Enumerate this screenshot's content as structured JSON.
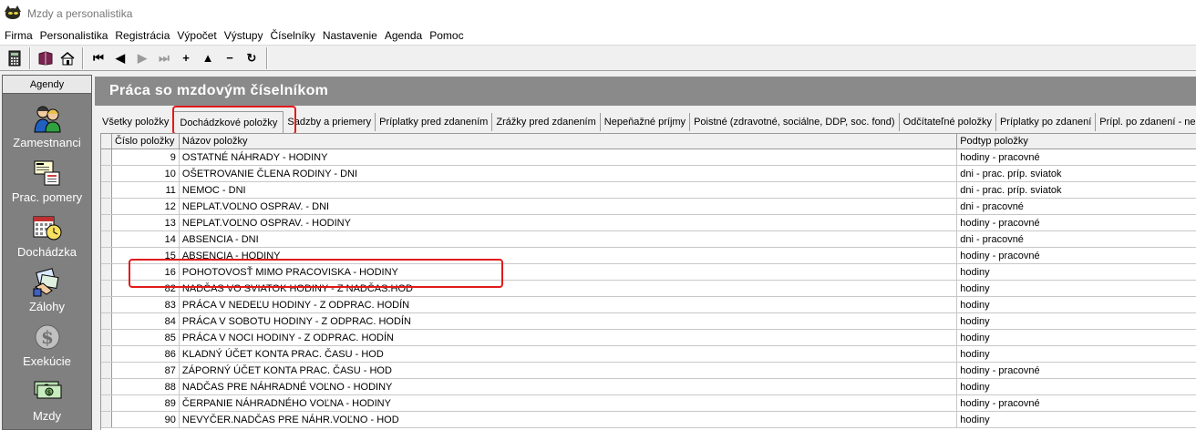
{
  "app": {
    "title": "Mzdy a personalistika",
    "logo_icon": "cat-logo-icon"
  },
  "menu": [
    "Firma",
    "Personalistika",
    "Registrácia",
    "Výpočet",
    "Výstupy",
    "Číselníky",
    "Nastavenie",
    "Agenda",
    "Pomoc"
  ],
  "toolbar": {
    "group1": [
      "calculator-icon",
      "book-icon",
      "home-icon"
    ],
    "nav": [
      {
        "icon": "first-record-icon",
        "glyph": "⏮",
        "disabled": false
      },
      {
        "icon": "prev-record-icon",
        "glyph": "◀",
        "disabled": false
      },
      {
        "icon": "next-record-icon",
        "glyph": "▶",
        "disabled": true
      },
      {
        "icon": "last-record-icon",
        "glyph": "⏭",
        "disabled": true
      },
      {
        "icon": "add-record-icon",
        "glyph": "+",
        "disabled": false
      },
      {
        "icon": "edit-record-icon",
        "glyph": "▲",
        "disabled": false
      },
      {
        "icon": "delete-record-icon",
        "glyph": "−",
        "disabled": false
      },
      {
        "icon": "refresh-icon",
        "glyph": "↻",
        "disabled": false
      }
    ]
  },
  "sidebar": {
    "header": "Agendy",
    "items": [
      {
        "label": "Zamestnanci",
        "icon": "employees-icon"
      },
      {
        "label": "Prac. pomery",
        "icon": "employment-contract-icon"
      },
      {
        "label": "Dochádzka",
        "icon": "attendance-calendar-icon"
      },
      {
        "label": "Zálohy",
        "icon": "advances-icon"
      },
      {
        "label": "Exekúcie",
        "icon": "garnishment-icon"
      },
      {
        "label": "Mzdy",
        "icon": "wages-icon"
      }
    ]
  },
  "main": {
    "title": "Práca so mzdovým číselníkom",
    "tabs": [
      {
        "label": "Všetky položky",
        "active": false
      },
      {
        "label": "Dochádzkové položky",
        "active": true
      },
      {
        "label": "Sadzby a priemery",
        "active": false
      },
      {
        "label": "Príplatky pred zdanením",
        "active": false
      },
      {
        "label": "Zrážky pred zdanením",
        "active": false
      },
      {
        "label": "Nepeňažné príjmy",
        "active": false
      },
      {
        "label": "Poistné (zdravotné, sociálne, DDP, soc. fond)",
        "active": false
      },
      {
        "label": "Odčítateľné položky",
        "active": false
      },
      {
        "label": "Príplatky po zdanení",
        "active": false
      },
      {
        "label": "Prípl. po zdanení - nemo",
        "active": false
      }
    ],
    "columns": {
      "number": "Číslo položky",
      "name": "Názov položky",
      "subtype": "Podtyp položky"
    },
    "rows": [
      {
        "number": "9",
        "name": "OSTATNÉ NÁHRADY - HODINY",
        "subtype": "hodiny - pracovné"
      },
      {
        "number": "10",
        "name": "OŠETROVANIE ČLENA RODINY - DNI",
        "subtype": "dni - prac. príp. sviatok"
      },
      {
        "number": "11",
        "name": "NEMOC - DNI",
        "subtype": "dni - prac. príp. sviatok"
      },
      {
        "number": "12",
        "name": "NEPLAT.VOĽNO OSPRAV. - DNI",
        "subtype": "dni - pracovné"
      },
      {
        "number": "13",
        "name": "NEPLAT.VOĽNO OSPRAV. - HODINY",
        "subtype": "hodiny - pracovné"
      },
      {
        "number": "14",
        "name": "ABSENCIA - DNI",
        "subtype": "dni - pracovné"
      },
      {
        "number": "15",
        "name": "ABSENCIA - HODINY",
        "subtype": "hodiny - pracovné"
      },
      {
        "number": "16",
        "name": "POHOTOVOSŤ MIMO PRACOVISKA - HODINY",
        "subtype": "hodiny"
      },
      {
        "number": "82",
        "name": "NADČAS VO SVIATOK HODINY - Z NADČAS.HOD",
        "subtype": "hodiny"
      },
      {
        "number": "83",
        "name": "PRÁCA V NEDEĽU HODINY - Z ODPRAC. HODÍN",
        "subtype": "hodiny"
      },
      {
        "number": "84",
        "name": "PRÁCA V SOBOTU HODINY - Z ODPRAC. HODÍN",
        "subtype": "hodiny"
      },
      {
        "number": "85",
        "name": "PRÁCA V NOCI HODINY - Z ODPRAC. HODÍN",
        "subtype": "hodiny"
      },
      {
        "number": "86",
        "name": "KLADNÝ ÚČET KONTA PRAC. ČASU - HOD",
        "subtype": "hodiny"
      },
      {
        "number": "87",
        "name": "ZÁPORNÝ ÚČET KONTA PRAC. ČASU - HOD",
        "subtype": "hodiny - pracovné"
      },
      {
        "number": "88",
        "name": "NADČAS PRE NÁHRADNÉ VOĽNO - HODINY",
        "subtype": "hodiny"
      },
      {
        "number": "89",
        "name": "ČERPANIE NÁHRADNÉHO VOĽNA - HODINY",
        "subtype": "hodiny - pracovné"
      },
      {
        "number": "90",
        "name": "NEVYČER.NADČAS PRE NÁHR.VOĽNO - HOD",
        "subtype": "hodiny"
      }
    ]
  },
  "colors": {
    "highlight": "#e21a1a",
    "panel_header": "#8a8a8a",
    "sidebar": "#808080"
  }
}
